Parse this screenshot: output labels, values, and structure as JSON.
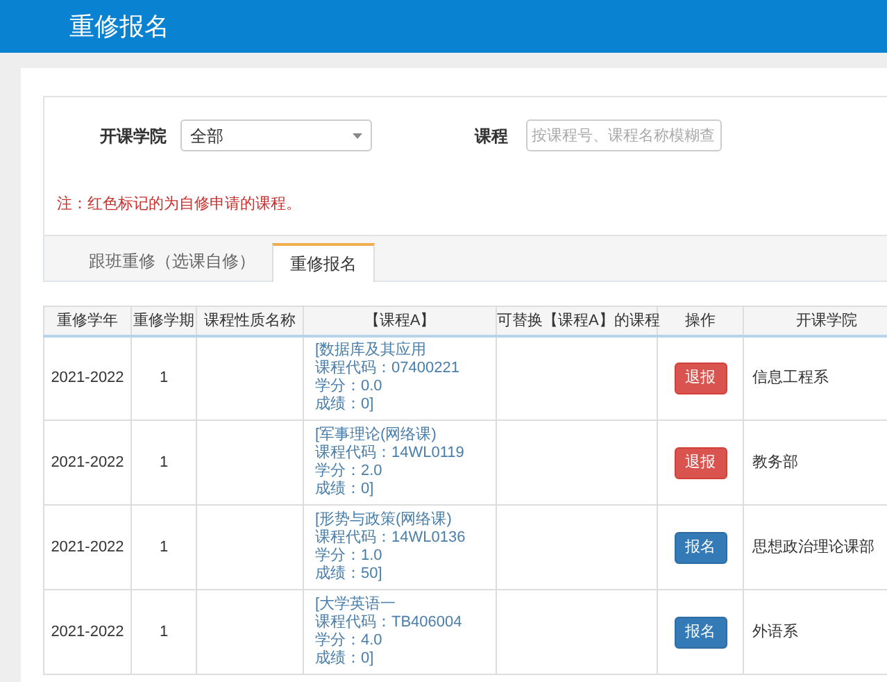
{
  "header": {
    "title": "重修报名"
  },
  "filters": {
    "college": {
      "label": "开课学院",
      "value": "全部"
    },
    "course": {
      "label": "课程",
      "placeholder": "按课程号、课程名称模糊查"
    }
  },
  "note": "注：红色标记的为自修申请的课程。",
  "tabs": [
    {
      "label": "跟班重修（选课自修）",
      "selected": false
    },
    {
      "label": "重修报名",
      "selected": true
    }
  ],
  "table": {
    "columns": [
      "重修学年",
      "重修学期",
      "课程性质名称",
      "【课程A】",
      "可替换【课程A】的课程",
      "操作",
      "开课学院"
    ],
    "rows": [
      {
        "year": "2021-2022",
        "term": "1",
        "course_lines": [
          "[数据库及其应用",
          "课程代码：07400221",
          "学分：0.0",
          "成绩：0]"
        ],
        "action": {
          "kind": "withdraw",
          "label": "退报"
        },
        "college": "信息工程系"
      },
      {
        "year": "2021-2022",
        "term": "1",
        "course_lines": [
          "[军事理论(网络课)",
          "课程代码：14WL0119",
          "学分：2.0",
          "成绩：0]"
        ],
        "action": {
          "kind": "withdraw",
          "label": "退报"
        },
        "college": "教务部"
      },
      {
        "year": "2021-2022",
        "term": "1",
        "course_lines": [
          "[形势与政策(网络课)",
          "课程代码：14WL0136",
          "学分：1.0",
          "成绩：50]"
        ],
        "action": {
          "kind": "register",
          "label": "报名"
        },
        "college": "思想政治理论课部"
      },
      {
        "year": "2021-2022",
        "term": "1",
        "course_lines": [
          "[大学英语一",
          "课程代码：TB406004",
          "学分：4.0",
          "成绩：0]"
        ],
        "action": {
          "kind": "register",
          "label": "报名"
        },
        "college": "外语系"
      }
    ]
  }
}
